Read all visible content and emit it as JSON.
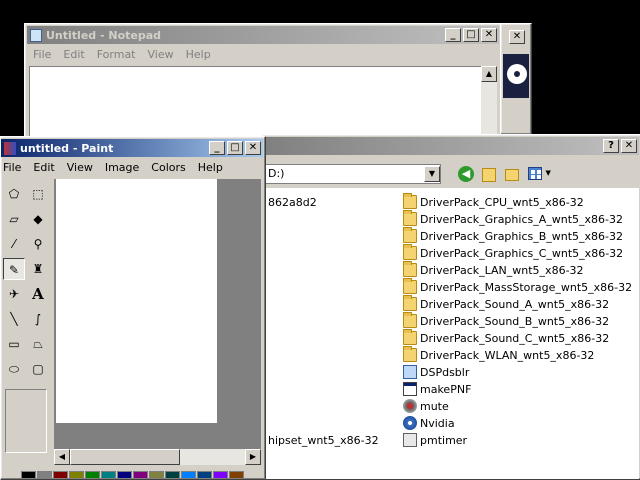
{
  "notepad": {
    "title": "Untitled - Notepad",
    "menu": [
      "File",
      "Edit",
      "Format",
      "View",
      "Help"
    ],
    "buttons": {
      "minimize": "_",
      "maximize": "□",
      "close": "✕"
    }
  },
  "background_window": {
    "close": "✕"
  },
  "paint": {
    "title": "untitled - Paint",
    "menu": [
      "File",
      "Edit",
      "View",
      "Image",
      "Colors",
      "Help"
    ],
    "buttons": {
      "minimize": "_",
      "maximize": "□",
      "close": "✕"
    },
    "palette_colors": [
      "#000000",
      "#808080",
      "#800000",
      "#808000",
      "#008000",
      "#008080",
      "#000080",
      "#800080",
      "#808040",
      "#004040",
      "#0080ff",
      "#004080",
      "#8000ff",
      "#804000"
    ]
  },
  "explorer": {
    "buttons": {
      "help": "?",
      "close": "✕"
    },
    "address_value": "D:)",
    "left_column": {
      "first_item": "862a8d2",
      "last_item": "hipset_wnt5_x86-32"
    },
    "items": [
      {
        "name": "DriverPack_CPU_wnt5_x86-32",
        "icon": "folder"
      },
      {
        "name": "DriverPack_Graphics_A_wnt5_x86-32",
        "icon": "folder"
      },
      {
        "name": "DriverPack_Graphics_B_wnt5_x86-32",
        "icon": "folder"
      },
      {
        "name": "DriverPack_Graphics_C_wnt5_x86-32",
        "icon": "folder"
      },
      {
        "name": "DriverPack_LAN_wnt5_x86-32",
        "icon": "folder"
      },
      {
        "name": "DriverPack_MassStorage_wnt5_x86-32",
        "icon": "folder"
      },
      {
        "name": "DriverPack_Sound_A_wnt5_x86-32",
        "icon": "folder"
      },
      {
        "name": "DriverPack_Sound_B_wnt5_x86-32",
        "icon": "folder"
      },
      {
        "name": "DriverPack_Sound_C_wnt5_x86-32",
        "icon": "folder"
      },
      {
        "name": "DriverPack_WLAN_wnt5_x86-32",
        "icon": "folder"
      },
      {
        "name": "DSPdsblr",
        "icon": "app"
      },
      {
        "name": "makePNF",
        "icon": "exe"
      },
      {
        "name": "mute",
        "icon": "gear"
      },
      {
        "name": "Nvidia",
        "icon": "disc"
      },
      {
        "name": "pmtimer",
        "icon": "pm"
      }
    ]
  }
}
